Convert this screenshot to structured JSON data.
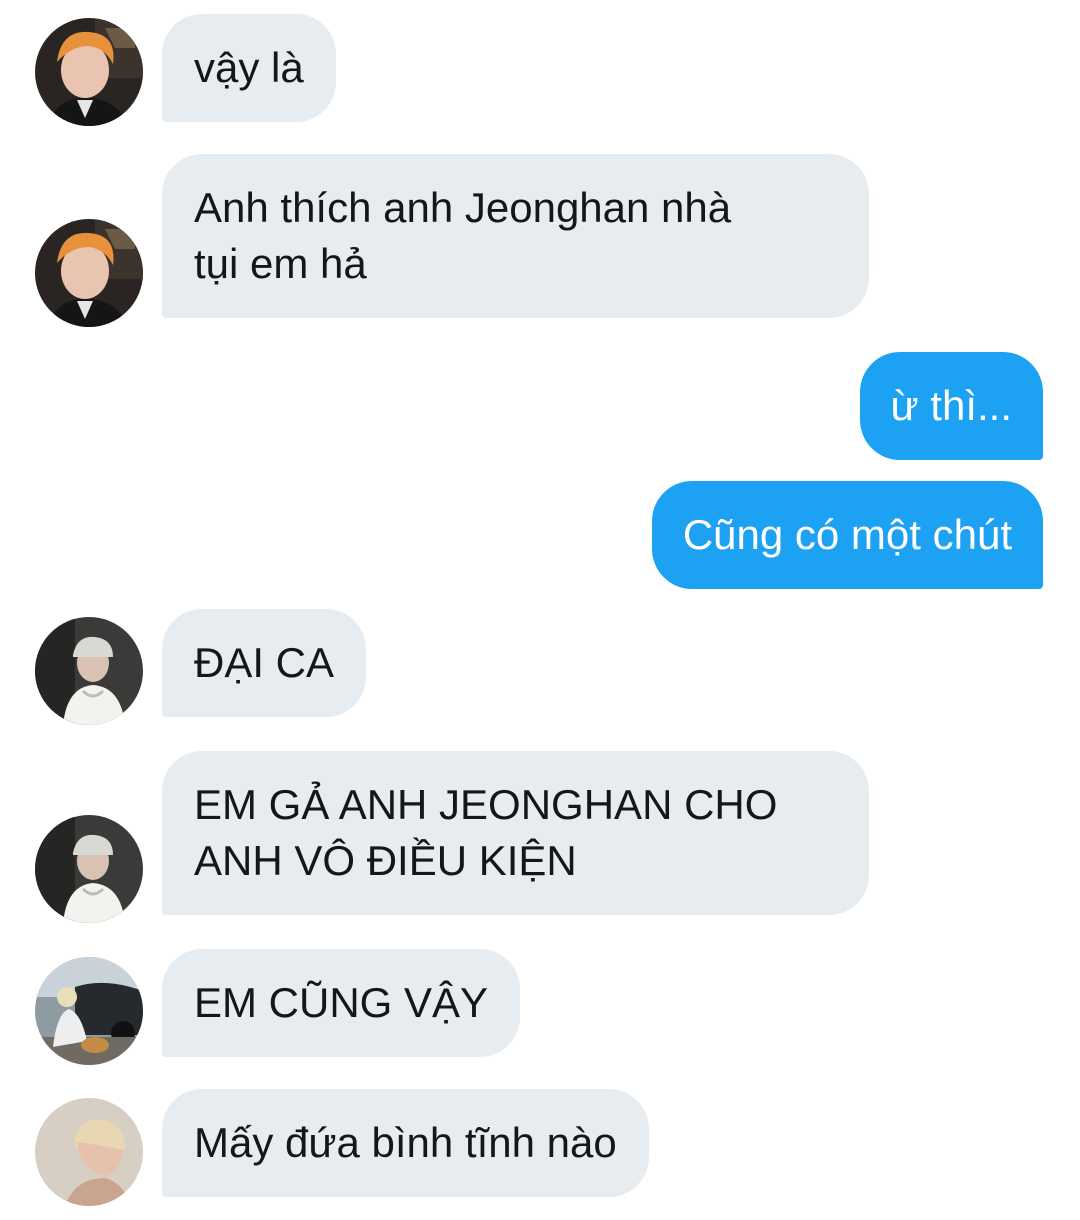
{
  "messages": [
    {
      "side": "in",
      "sender_avatar": "orange-hair-avatar",
      "text": "vậy là"
    },
    {
      "side": "in",
      "sender_avatar": "orange-hair-avatar",
      "text": "Anh thích anh Jeonghan nhà\ntụi em hả"
    },
    {
      "side": "out",
      "text": "ừ thì..."
    },
    {
      "side": "out",
      "text": "Cũng có một chút"
    },
    {
      "side": "in",
      "sender_avatar": "white-cap-avatar",
      "text": "ĐẠI CA"
    },
    {
      "side": "in",
      "sender_avatar": "white-cap-avatar",
      "text": "EM GẢ ANH JEONGHAN CHO\nANH VÔ ĐIỀU KIỆN"
    },
    {
      "side": "in",
      "sender_avatar": "car-dog-avatar",
      "text": "EM CŨNG VẬY"
    },
    {
      "side": "in",
      "sender_avatar": "blonde-profile-avatar",
      "text": "Mấy đứa bình tĩnh nào"
    }
  ],
  "colors": {
    "incoming_bubble": "#e6ecf0",
    "outgoing_bubble": "#1da1f2",
    "incoming_text": "#14171a",
    "outgoing_text": "#ffffff"
  }
}
